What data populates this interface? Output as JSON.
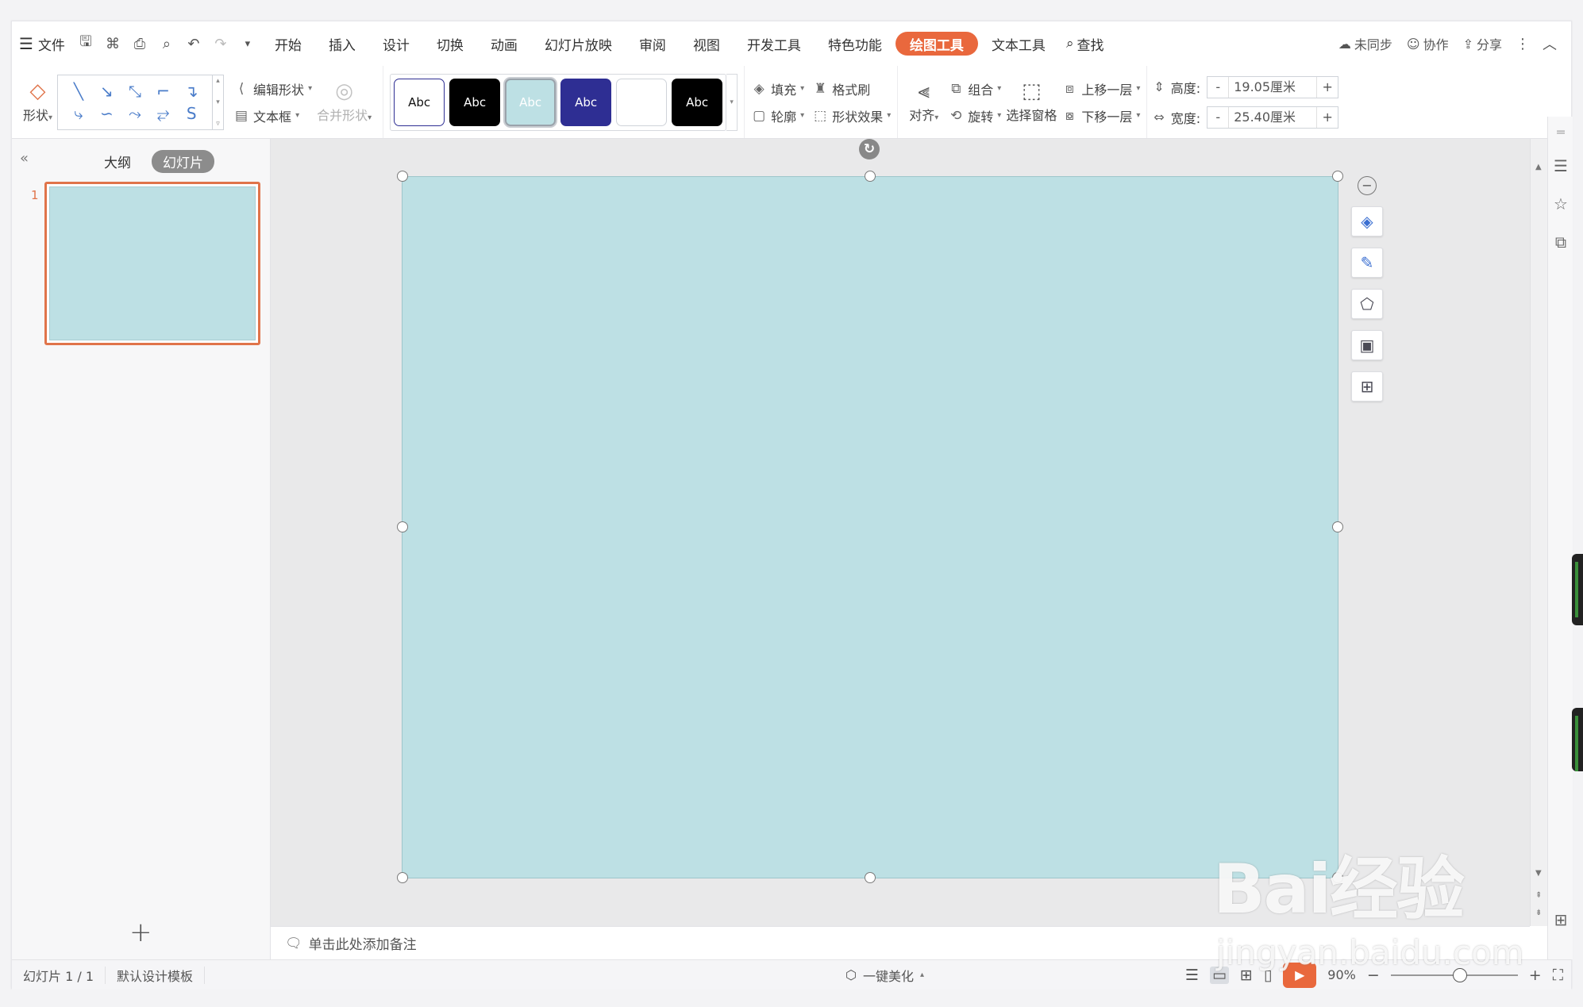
{
  "menubar": {
    "file_label": "文件",
    "tabs": [
      "开始",
      "插入",
      "设计",
      "切换",
      "动画",
      "幻灯片放映",
      "审阅",
      "视图",
      "开发工具",
      "特色功能",
      "绘图工具",
      "文本工具"
    ],
    "active_tab": "绘图工具",
    "search_label": "查找",
    "sync_label": "未同步",
    "collab_label": "协作",
    "share_label": "分享"
  },
  "ribbon": {
    "shape_label": "形状",
    "edit_shape_label": "编辑形状",
    "textbox_label": "文本框",
    "merge_shape_label": "合并形状",
    "style_swatch_text": "Abc",
    "fill_label": "填充",
    "format_brush_label": "格式刷",
    "outline_label": "轮廓",
    "shape_effect_label": "形状效果",
    "align_label": "对齐",
    "group_label": "组合",
    "rotate_label": "旋转",
    "select_pane_label": "选择窗格",
    "bring_forward_label": "上移一层",
    "send_backward_label": "下移一层",
    "height_label": "高度:",
    "height_value": "19.05厘米",
    "width_label": "宽度:",
    "width_value": "25.40厘米"
  },
  "colors": {
    "accent": "#e9683d",
    "slide_fill": "#bde0e4",
    "swatch_navy": "#2e2e93",
    "line_icons": "#4a7cc9"
  },
  "left_panel": {
    "outline_tab": "大纲",
    "slides_tab": "幻灯片",
    "slide_number": "1"
  },
  "notes": {
    "placeholder": "单击此处添加备注"
  },
  "statusbar": {
    "slide_info": "幻灯片 1 / 1",
    "template": "默认设计模板",
    "beautify_label": "一键美化",
    "zoom": "90%"
  },
  "watermark": {
    "main": "Bai经验",
    "sub": "jingyan.baidu.com"
  }
}
